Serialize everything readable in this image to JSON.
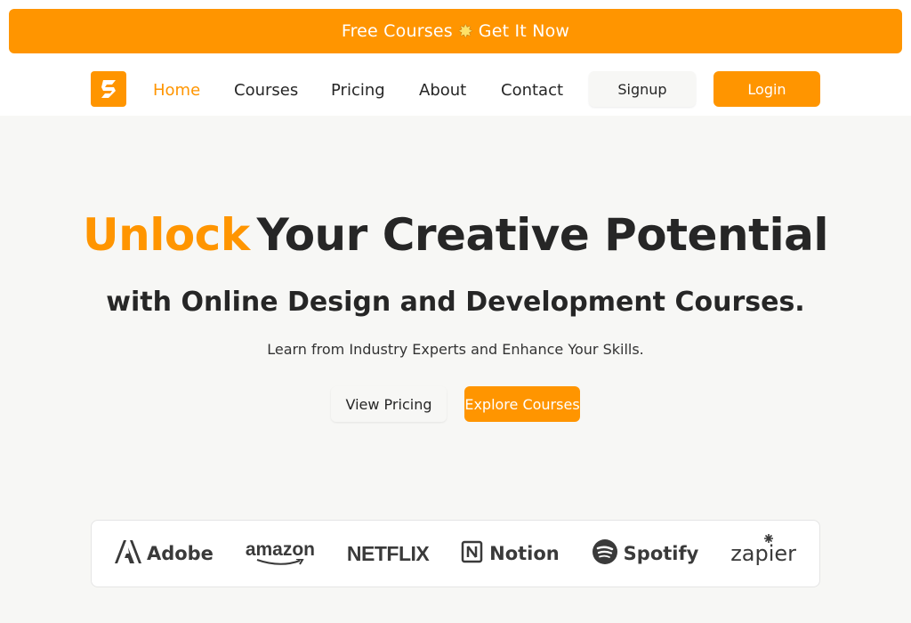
{
  "announcement": {
    "text_before": "Free Courses",
    "star_glyph": "✸",
    "text_after": "Get It Now"
  },
  "nav": {
    "links": [
      "Home",
      "Courses",
      "Pricing",
      "About",
      "Contact"
    ],
    "active": "Home",
    "signup_label": "Signup",
    "login_label": "Login"
  },
  "hero": {
    "headline_accent": "Unlock",
    "headline_rest": "Your Creative Potential",
    "subheadline": "with Online Design and Development Courses.",
    "tagline": "Learn from Industry Experts and Enhance Your Skills.",
    "view_pricing_label": "View Pricing",
    "explore_label": "Explore Courses"
  },
  "brands": {
    "adobe": "Adobe",
    "amazon": "amazon",
    "netflix": "NETFLIX",
    "notion": "Notion",
    "spotify": "Spotify",
    "zapier": "zapier"
  },
  "colors": {
    "accent": "#ff9500",
    "text": "#262626",
    "background": "#f7f7f5"
  },
  "icons": [
    "logo-icon",
    "star-icon",
    "adobe-icon",
    "notion-icon",
    "spotify-icon"
  ]
}
